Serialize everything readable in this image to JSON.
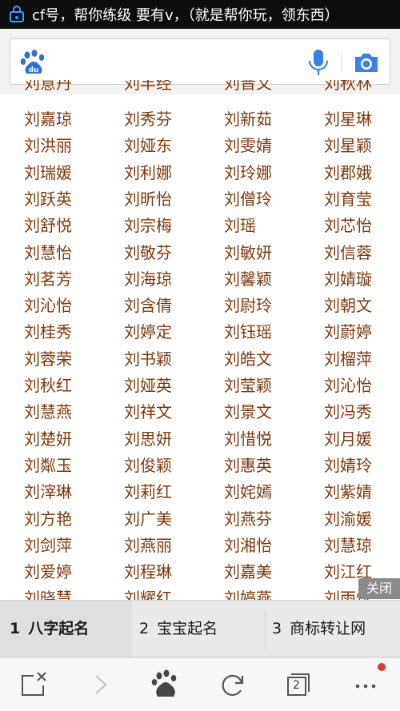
{
  "status_bar": {
    "notification_text": "cf号，帮你练级 要有v，（就是帮你玩，领东西）"
  },
  "search": {
    "logo_text": "du",
    "icons": [
      "baidu-paw-icon",
      "microphone-icon",
      "camera-icon"
    ]
  },
  "names": {
    "partial_top_row": [
      "刘意丹",
      "刘丰经",
      "刘晋文",
      "刘秋林"
    ],
    "rows": [
      [
        "刘嘉琼",
        "刘秀芬",
        "刘新茹",
        "刘星琳"
      ],
      [
        "刘洪丽",
        "刘娅东",
        "刘雯婧",
        "刘星颖"
      ],
      [
        "刘瑞媛",
        "刘利娜",
        "刘玲娜",
        "刘郡娥"
      ],
      [
        "刘跃英",
        "刘昕怡",
        "刘僧玲",
        "刘育莹"
      ],
      [
        "刘舒悦",
        "刘宗梅",
        "刘瑶",
        "刘芯怡"
      ],
      [
        "刘慧怡",
        "刘敬芬",
        "刘敏妍",
        "刘信蓉"
      ],
      [
        "刘茗芳",
        "刘海琼",
        "刘馨颖",
        "刘婧璇"
      ],
      [
        "刘沁怡",
        "刘含倩",
        "刘尉玲",
        "刘朝文"
      ],
      [
        "刘桂秀",
        "刘婷定",
        "刘钰瑶",
        "刘蔚婷"
      ],
      [
        "刘蓉荣",
        "刘书颖",
        "刘皓文",
        "刘榴萍"
      ],
      [
        "刘秋红",
        "刘娅英",
        "刘莹颖",
        "刘沁怡"
      ],
      [
        "刘慧燕",
        "刘祥文",
        "刘景文",
        "刘冯秀"
      ],
      [
        "刘楚妍",
        "刘思妍",
        "刘惜悦",
        "刘月媛"
      ],
      [
        "刘粼玉",
        "刘俊颖",
        "刘惠英",
        "刘婧玲"
      ],
      [
        "刘滓琳",
        "刘莉红",
        "刘姹嫣",
        "刘紫婧"
      ],
      [
        "刘方艳",
        "刘广美",
        "刘燕芬",
        "刘渝媛"
      ],
      [
        "刘剑萍",
        "刘燕丽",
        "刘湘怡",
        "刘慧琼"
      ],
      [
        "刘爱婷",
        "刘程琳",
        "刘嘉美",
        "刘江红"
      ]
    ],
    "partial_bottom_row": [
      "刘晓慧",
      "刘耀红",
      "刘婷燕",
      "刘雨悦"
    ]
  },
  "close_label": "关闭",
  "suggestions": [
    {
      "num": "1",
      "label": "八字起名",
      "active": true
    },
    {
      "num": "2",
      "label": "宝宝起名",
      "active": false
    },
    {
      "num": "3",
      "label": "商标转让网",
      "active": false
    }
  ],
  "nav": {
    "tab_count": "2",
    "icons": [
      "close-page-icon",
      "forward-icon",
      "baidu-home-icon",
      "refresh-icon",
      "tabs-icon",
      "more-icon"
    ],
    "notification_dot_color": "#e8332f"
  },
  "colors": {
    "name_text": "#7a3a10",
    "baidu_blue": "#2f6fd6"
  }
}
